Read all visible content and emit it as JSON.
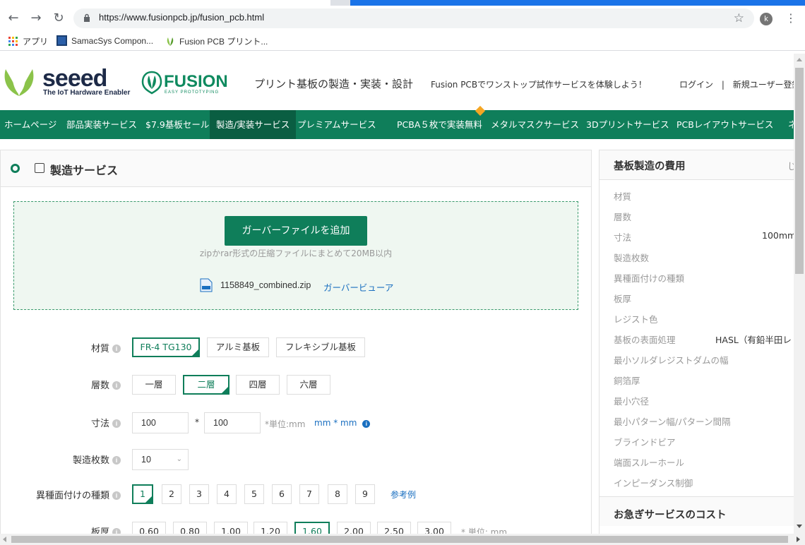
{
  "browser": {
    "url": "https://www.fusionpcb.jp/fusion_pcb.html",
    "profile_initial": "k",
    "bookmarks": [
      {
        "label": "アプリ",
        "icon": "apps-grid-icon"
      },
      {
        "label": "SamacSys Compon...",
        "icon": "samacsys-icon"
      },
      {
        "label": "Fusion PCB プリント...",
        "icon": "fusion-leaf-icon"
      }
    ]
  },
  "header": {
    "seeed_logo": "seeed",
    "seeed_tagline": "The IoT Hardware Enabler",
    "fusion_logo": "FUSION",
    "fusion_tagline": "EASY PROTOTYPING",
    "title": "プリント基板の製造・実装・設計",
    "subtitle": "Fusion PCBでワンストップ試作サービスを体験しよう！",
    "login": "ログイン",
    "separator": "|",
    "register": "新規ユーザー登録"
  },
  "nav": {
    "items": [
      {
        "label": "ホームページ"
      },
      {
        "label": "部品実装サービス"
      },
      {
        "label": "$7.9基板セール"
      },
      {
        "label": "製造/実装サービス"
      },
      {
        "label": "プレミアムサービス"
      },
      {
        "label": "PCBA５枚で実装無料"
      },
      {
        "label": "メタルマスクサービス"
      },
      {
        "label": "3Dプリントサービス"
      },
      {
        "label": "PCBレイアウトサービス"
      },
      {
        "label": "ネ"
      }
    ]
  },
  "service": {
    "title": "製造サービス",
    "upload_button": "ガーバーファイルを追加",
    "upload_hint": "zipかrar形式の圧縮ファイルにまとめて20MB以内",
    "file_name": "1158849_combined.zip",
    "gerber_viewer": "ガーバービューア",
    "material": {
      "label": "材質",
      "options": [
        "FR-4 TG130",
        "アルミ基板",
        "フレキシブル基板"
      ]
    },
    "layers": {
      "label": "層数",
      "options": [
        "一層",
        "二層",
        "四層",
        "六層"
      ]
    },
    "dimensions": {
      "label": "寸法",
      "width": "100",
      "times": "*",
      "height": "100",
      "unit": "*単位:mm",
      "unit_toggle": "mm * mm"
    },
    "quantity": {
      "label": "製造枚数",
      "value": "10"
    },
    "designs": {
      "label": "異種面付けの種類",
      "options": [
        "1",
        "2",
        "3",
        "4",
        "5",
        "6",
        "7",
        "8",
        "9"
      ],
      "example": "参考例"
    },
    "thickness": {
      "label": "板厚",
      "options": [
        "0.60",
        "0.80",
        "1.00",
        "1.20",
        "1.60",
        "2.00",
        "2.50",
        "3.00"
      ],
      "unit": "* 単位: mm"
    }
  },
  "cost": {
    "title": "基板製造の費用",
    "title_cut": "じ",
    "rows": [
      {
        "label": "材質",
        "value": ""
      },
      {
        "label": "層数",
        "value": ""
      },
      {
        "label": "寸法",
        "value": "100mm"
      },
      {
        "label": "製造枚数",
        "value": ""
      },
      {
        "label": "異種面付けの種類",
        "value": ""
      },
      {
        "label": "板厚",
        "value": ""
      },
      {
        "label": "レジスト色",
        "value": ""
      },
      {
        "label": "基板の表面処理",
        "value": "HASL（有鉛半田レ"
      },
      {
        "label": "最小ソルダレジストダムの幅",
        "value": ""
      },
      {
        "label": "銅箔厚",
        "value": ""
      },
      {
        "label": "最小穴径",
        "value": ""
      },
      {
        "label": "最小パターン幅/パターン間隔",
        "value": ""
      },
      {
        "label": "ブラインドビア",
        "value": ""
      },
      {
        "label": "端面スルーホール",
        "value": ""
      },
      {
        "label": "インピーダンス制御",
        "value": ""
      }
    ],
    "rush_title": "お急ぎサービスのコスト"
  },
  "colors": {
    "accent": "#0f7e5a",
    "accent_dark": "#0a5e42",
    "link": "#1a6fc0",
    "upload_bg": "#eff7f1"
  }
}
